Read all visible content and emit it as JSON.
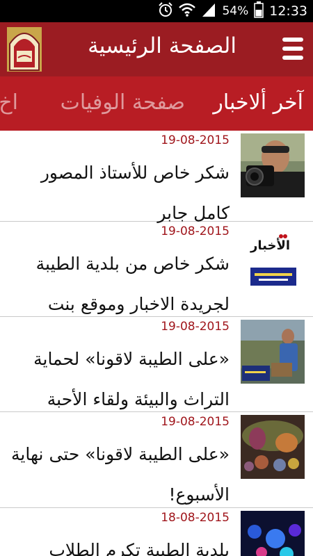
{
  "status_bar": {
    "battery_percent": "54%",
    "time": "12:33"
  },
  "header": {
    "title": "الصفحة الرئيسية"
  },
  "tabs": [
    {
      "label": "آخر ألاخبار"
    },
    {
      "label": "صفحة الوفيات"
    },
    {
      "label": "اخ"
    }
  ],
  "articles": [
    {
      "date": "19-08-2015",
      "title": "شكر خاص للأستاذ المصور كامل جابر"
    },
    {
      "date": "19-08-2015",
      "title": "شكر خاص من بلدية الطيبة لجريدة الاخبار وموقع بنت",
      "thumb_text": "الأخبار"
    },
    {
      "date": "19-08-2015",
      "title": "«على الطيبة لاقونا» لحماية التراث والبيئة ولقاء الأحبة"
    },
    {
      "date": "19-08-2015",
      "title": "«على الطيبة لاقونا» حتى نهاية الأسبوع!"
    },
    {
      "date": "18-08-2015",
      "title": "بلدية الطيبة تكرم الطلاب"
    }
  ],
  "colors": {
    "header": "#9b1c22",
    "tabs": "#b81d24",
    "date": "#a0161c"
  }
}
